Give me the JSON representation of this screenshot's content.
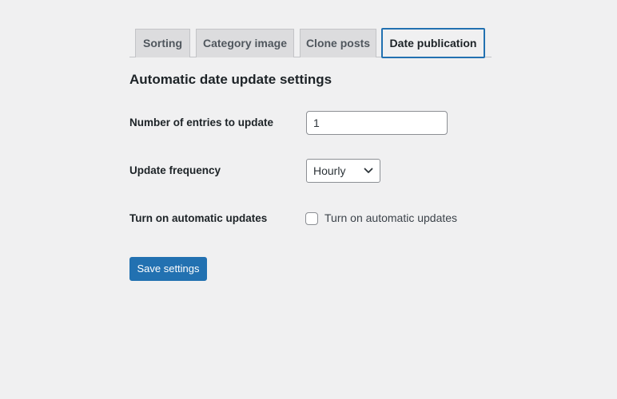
{
  "tabs": [
    {
      "label": "Sorting"
    },
    {
      "label": "Category image"
    },
    {
      "label": "Clone posts"
    },
    {
      "label": "Date publication",
      "active": true
    }
  ],
  "section": {
    "heading": "Automatic date update settings"
  },
  "fields": {
    "entries": {
      "label": "Number of entries to update",
      "value": "1"
    },
    "frequency": {
      "label": "Update frequency",
      "selected": "Hourly"
    },
    "auto": {
      "label": "Turn on automatic updates",
      "checkbox_label": "Turn on automatic updates",
      "checked": false
    }
  },
  "actions": {
    "save_label": "Save settings"
  },
  "colors": {
    "accent": "#2271b1",
    "background": "#f0f0f1"
  }
}
